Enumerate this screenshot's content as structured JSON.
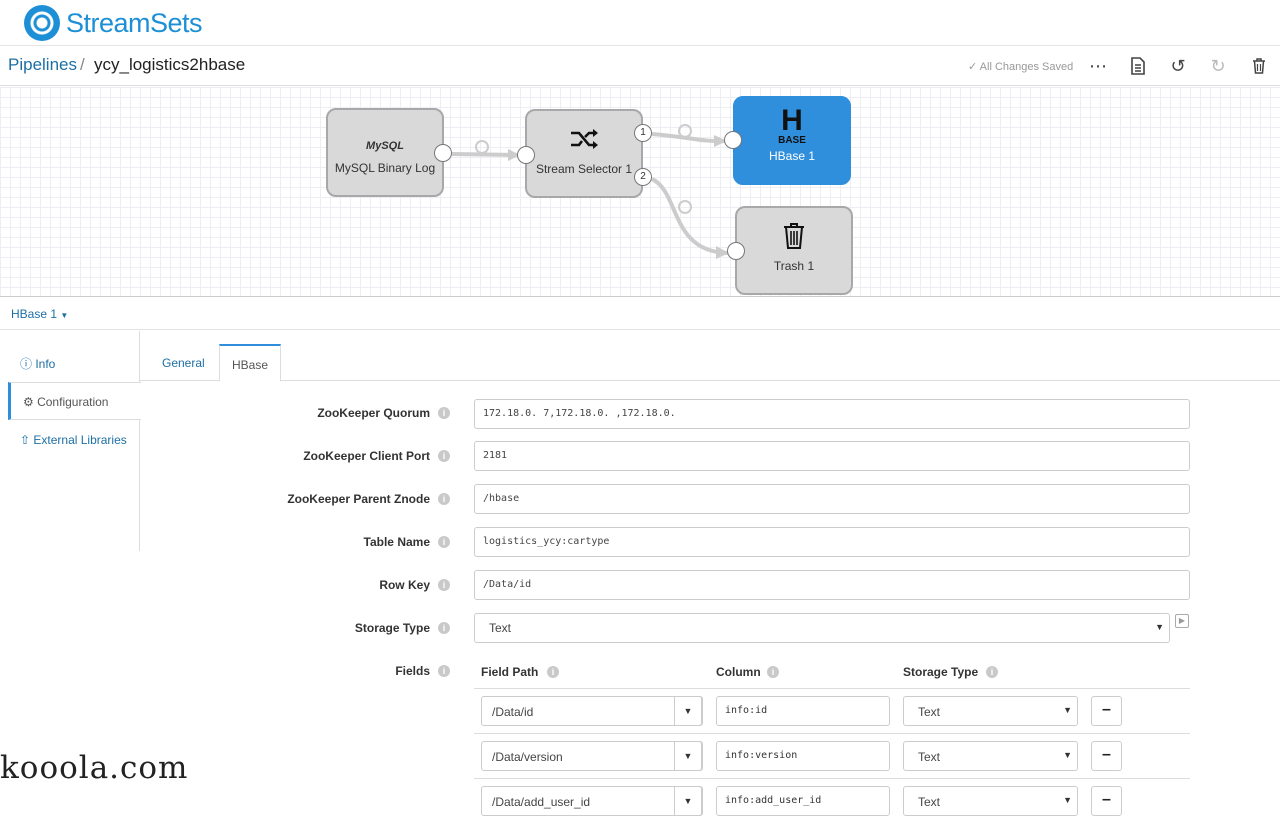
{
  "app": {
    "name": "StreamSets"
  },
  "breadcrumb": {
    "root": "Pipelines",
    "separator": "/",
    "current": "ycy_logistics2hbase"
  },
  "toolbar": {
    "saved_status": "All Changes Saved"
  },
  "canvas": {
    "nodes": {
      "mysql": {
        "label": "MySQL Binary Log",
        "icon_text": "MySQL"
      },
      "selector": {
        "label": "Stream Selector 1"
      },
      "hbase": {
        "label": "HBase 1",
        "icon_text_top": "H",
        "icon_text_bottom": "BASE"
      },
      "trash": {
        "label": "Trash 1"
      }
    },
    "ports": {
      "one": "1",
      "two": "2"
    }
  },
  "stage": {
    "name": "HBase 1"
  },
  "leftnav": {
    "info": "Info",
    "configuration": "Configuration",
    "external_libraries": "External Libraries"
  },
  "tabs": {
    "general": "General",
    "hbase": "HBase"
  },
  "form": {
    "zk_quorum": {
      "label": "ZooKeeper Quorum",
      "value": "172.18.0.  7,172.18.0.  ,172.18.0."
    },
    "zk_port": {
      "label": "ZooKeeper Client Port",
      "value": "2181"
    },
    "zk_znode": {
      "label": "ZooKeeper Parent Znode",
      "value": "/hbase"
    },
    "table_name": {
      "label": "Table Name",
      "value": "logistics_ycy:cartype"
    },
    "row_key": {
      "label": "Row Key",
      "value": "/Data/id"
    },
    "storage_type": {
      "label": "Storage Type",
      "value": "Text"
    },
    "fields": {
      "label": "Fields",
      "headers": {
        "field_path": "Field Path",
        "column": "Column",
        "storage_type": "Storage Type"
      },
      "rows": [
        {
          "field_path": "/Data/id",
          "column": "info:id",
          "storage_type": "Text"
        },
        {
          "field_path": "/Data/version",
          "column": "info:version",
          "storage_type": "Text"
        },
        {
          "field_path": "/Data/add_user_id",
          "column": "info:add_user_id",
          "storage_type": "Text"
        }
      ]
    }
  },
  "watermark": "kooola.com"
}
